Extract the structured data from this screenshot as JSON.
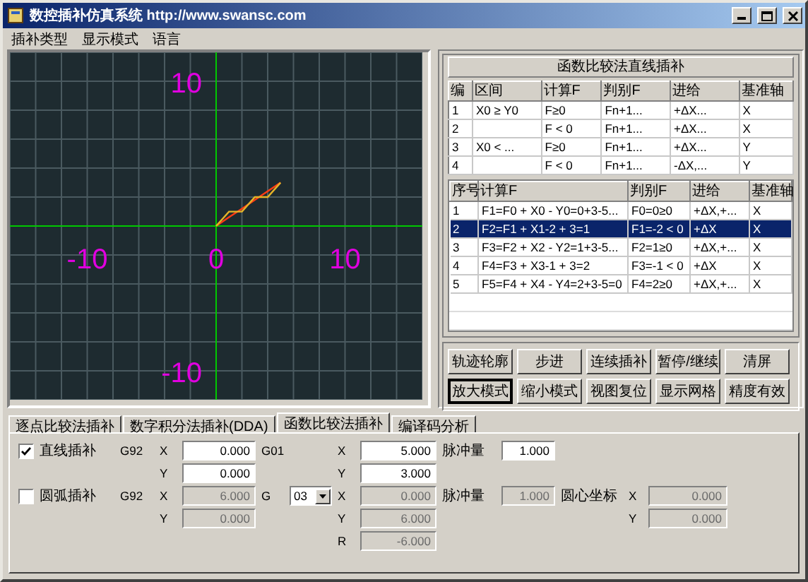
{
  "window": {
    "title": "数控插补仿真系统 http://www.swansc.com"
  },
  "menu": [
    "插补类型",
    "显示模式",
    "语言"
  ],
  "canvas": {
    "chart_data": {
      "type": "line",
      "x": [
        0,
        1,
        2,
        3,
        4,
        5
      ],
      "xlim": [
        -16,
        16
      ],
      "ylim": [
        -12,
        12
      ],
      "xticks": [
        -10,
        0,
        10
      ],
      "yticks": [
        -10,
        10
      ],
      "grid": true,
      "series": [
        {
          "color": "#ff3c14",
          "values": [
            0,
            0.6,
            1.2,
            1.8,
            2.4,
            3
          ]
        },
        {
          "color": "#e6b428",
          "values": [
            0,
            1,
            1,
            2,
            2,
            3
          ]
        }
      ]
    }
  },
  "group_title": "函数比较法直线插补",
  "rule_table": {
    "columns": [
      "编",
      "区间",
      "计算F",
      "判别F",
      "进给",
      "基准轴"
    ],
    "rows": [
      {
        "no": "1",
        "interval": "X0 ≥ Y0",
        "calc": "F≥0",
        "judge": "Fn+1...",
        "feed": "+ΔX...",
        "axis": "X"
      },
      {
        "no": "2",
        "calc": "F < 0",
        "judge": "Fn+1...",
        "feed": "+ΔX...",
        "axis": "X"
      },
      {
        "no": "3",
        "interval": "X0 < ...",
        "calc": "F≥0",
        "judge": "Fn+1...",
        "feed": "+ΔX...",
        "axis": "Y"
      },
      {
        "no": "4",
        "calc": "F < 0",
        "judge": "Fn+1...",
        "feed": "-ΔX,...",
        "axis": "Y"
      }
    ]
  },
  "step_table": {
    "columns": [
      "序号",
      "计算F",
      "判别F",
      "进给",
      "基准轴"
    ],
    "rows": [
      {
        "no": "1",
        "calc": "F1=F0 + X0 - Y0=0+3-5...",
        "judge": "F0=0≥0",
        "feed": "+ΔX,+...",
        "axis": "X",
        "selected": false
      },
      {
        "no": "2",
        "calc": "F2=F1 + X1-2 + 3=1",
        "judge": "F1=-2 < 0",
        "feed": "+ΔX",
        "axis": "X",
        "selected": true
      },
      {
        "no": "3",
        "calc": "F3=F2 + X2 - Y2=1+3-5...",
        "judge": "F2=1≥0",
        "feed": "+ΔX,+...",
        "axis": "X",
        "selected": false
      },
      {
        "no": "4",
        "calc": "F4=F3 + X3-1 + 3=2",
        "judge": "F3=-1 < 0",
        "feed": "+ΔX",
        "axis": "X",
        "selected": false
      },
      {
        "no": "5",
        "calc": "F5=F4 + X4 - Y4=2+3-5=0",
        "judge": "F4=2≥0",
        "feed": "+ΔX,+...",
        "axis": "X",
        "selected": false
      }
    ]
  },
  "buttons": [
    {
      "label": "轨迹轮廓",
      "pressed": false
    },
    {
      "label": "步进",
      "pressed": false
    },
    {
      "label": "连续插补",
      "pressed": false
    },
    {
      "label": "暂停/继续",
      "pressed": false
    },
    {
      "label": "清屏",
      "pressed": false
    },
    {
      "label": "放大模式",
      "pressed": true
    },
    {
      "label": "缩小模式",
      "pressed": false
    },
    {
      "label": "视图复位",
      "pressed": false
    },
    {
      "label": "显示网格",
      "pressed": false
    },
    {
      "label": "精度有效",
      "pressed": false
    }
  ],
  "tabs": [
    {
      "label": "逐点比较法插补",
      "selected": false
    },
    {
      "label": "数字积分法插补(DDA)",
      "selected": false
    },
    {
      "label": "函数比较法插补",
      "selected": true
    },
    {
      "label": "编译码分析",
      "selected": false
    }
  ],
  "line": {
    "label": "直线插补",
    "checked": true,
    "start_code": "G92",
    "start": [
      {
        "axis": "X",
        "value": "0.000",
        "disabled": false
      },
      {
        "axis": "Y",
        "value": "0.000",
        "disabled": false
      }
    ],
    "end_code": "G01",
    "end": [
      {
        "axis": "X",
        "value": "5.000",
        "disabled": false
      },
      {
        "axis": "Y",
        "value": "3.000",
        "disabled": false
      }
    ],
    "pulse_label": "脉冲量",
    "pulse": {
      "value": "1.000",
      "disabled": false
    }
  },
  "arc": {
    "label": "圆弧插补",
    "checked": false,
    "start_code": "G92",
    "start": [
      {
        "axis": "X",
        "value": "6.000",
        "disabled": true
      },
      {
        "axis": "Y",
        "value": "0.000",
        "disabled": true
      }
    ],
    "g_label": "G",
    "g_value": "03",
    "end": [
      {
        "axis": "X",
        "value": "0.000",
        "disabled": true
      },
      {
        "axis": "Y",
        "value": "6.000",
        "disabled": true
      },
      {
        "axis": "R",
        "value": "-6.000",
        "disabled": true
      }
    ],
    "pulse_label": "脉冲量",
    "pulse": {
      "value": "1.000",
      "disabled": true
    },
    "center_label": "圆心坐标",
    "center": [
      {
        "axis": "X",
        "value": "0.000",
        "disabled": true
      },
      {
        "axis": "Y",
        "value": "0.000",
        "disabled": true
      }
    ]
  }
}
